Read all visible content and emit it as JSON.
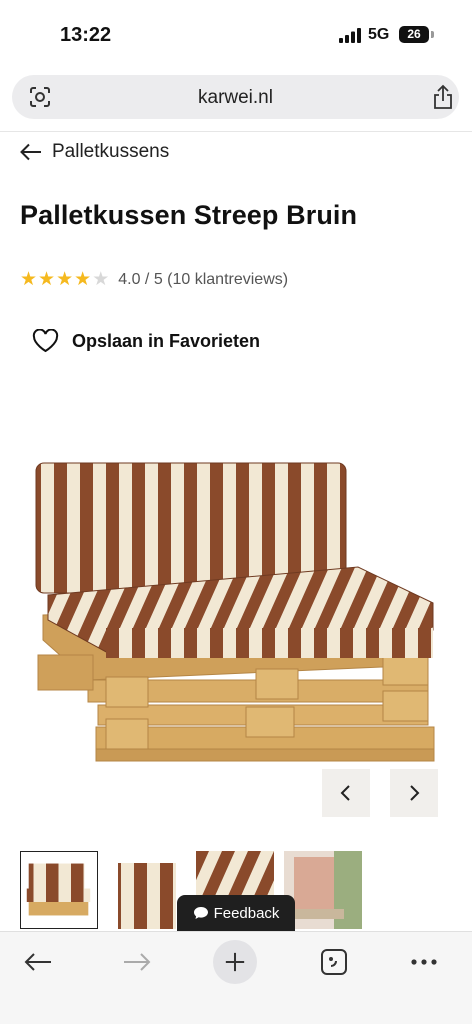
{
  "status": {
    "time": "13:22",
    "network": "5G",
    "battery": "26"
  },
  "browser": {
    "url": "karwei.nl",
    "feedback_label": "Feedback"
  },
  "breadcrumb": {
    "label": "Palletkussens"
  },
  "product": {
    "title": "Palletkussen Streep Bruin",
    "rating_value": 4,
    "rating_max": 5,
    "rating_text": "4.0 / 5 (10 klantreviews)",
    "favorite_label": "Opslaan in Favorieten"
  },
  "gallery": {
    "thumbnail_count": 4,
    "selected_index": 0
  },
  "colors": {
    "stripe_brown": "#8a4a2b",
    "stripe_cream": "#f2e8d4",
    "wood": "#d7aa62",
    "star": "#f5b91f"
  }
}
